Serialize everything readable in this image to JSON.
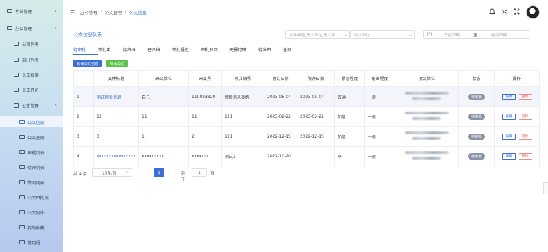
{
  "sidebar": {
    "items": [
      {
        "label": "考试管理",
        "icon": "folder-icon",
        "arrow": "∨"
      },
      {
        "label": "办公管理",
        "icon": "folder-icon",
        "arrow": "∧"
      },
      {
        "label": "公司列表",
        "icon": "folder-icon"
      },
      {
        "label": "部门列表",
        "icon": "folder-icon"
      },
      {
        "label": "员工档案",
        "icon": "folder-icon"
      },
      {
        "label": "员工评价",
        "icon": "folder-icon"
      },
      {
        "label": "公文管理",
        "icon": "folder-icon",
        "arrow": "∧"
      },
      {
        "label": "公文信息",
        "icon": "folder-icon"
      },
      {
        "label": "公文查阅",
        "icon": "folder-icon"
      },
      {
        "label": "审批列表",
        "icon": "folder-icon"
      },
      {
        "label": "待办列表",
        "icon": "folder-icon"
      },
      {
        "label": "传阅列表",
        "icon": "folder-icon"
      },
      {
        "label": "公文审批流",
        "icon": "folder-icon"
      },
      {
        "label": "公文附件",
        "icon": "folder-icon"
      },
      {
        "label": "我的收藏",
        "icon": "folder-icon"
      },
      {
        "label": "常用语",
        "icon": "folder-icon"
      }
    ]
  },
  "header": {
    "menu_icon": "☰",
    "breadcrumb": [
      "办公管理",
      "公文管理",
      "公文信息"
    ],
    "sep": "/",
    "icons": [
      "bell-icon",
      "tools-icon",
      "fullscreen-icon"
    ]
  },
  "main": {
    "title": "公文信息列表",
    "search": {
      "keyword_placeholder": "文件标题/来文单位/来文号",
      "unit_placeholder": "收文单位",
      "search_icon": "⌕",
      "date_start_placeholder": "开始日期",
      "date_to": "至",
      "date_end_placeholder": "结束日期"
    },
    "tabs": [
      "待审批",
      "审批中",
      "待归档",
      "已归档",
      "审批通过",
      "审批驳回",
      "无需过审",
      "待发布",
      "全部"
    ],
    "buttons": {
      "add": "新增公文信息",
      "export": "导出公文"
    },
    "table": {
      "columns": [
        "",
        "文件标题",
        "来文单位",
        "来文号",
        "收文编号",
        "收文日期",
        "限办日期",
        "紧急程度",
        "秘密程度",
        "收文单位",
        "状态",
        "操作"
      ],
      "rows": [
        {
          "idx": "1",
          "title": "测试模板消息",
          "from": "自己",
          "doc_no": "110023320",
          "recv_no": "模板消息提醒",
          "recv_date": "2023-05-04",
          "limit_date": "2023-05-04",
          "urgency": "普通",
          "secret": "一般",
          "status": "待审批",
          "edit": "编辑",
          "delete": "删除"
        },
        {
          "idx": "2",
          "title": "11",
          "from": "11",
          "doc_no": "11",
          "recv_no": "111",
          "recv_date": "2023-02-22",
          "limit_date": "2023-02-22",
          "urgency": "加急",
          "secret": "一般",
          "status": "待审批",
          "edit": "编辑",
          "delete": "删除"
        },
        {
          "idx": "3",
          "title": "3",
          "from": "1",
          "doc_no": "2",
          "recv_no": "111",
          "recv_date": "2022-12-15",
          "limit_date": "2022-12-15",
          "urgency": "加急",
          "secret": "一般",
          "status": "待审批",
          "edit": "编辑",
          "delete": "删除"
        },
        {
          "idx": "4",
          "title": "xxxxxxxxxxxxxxxx",
          "from": "xxxxxxxxx",
          "doc_no": "xxxxxxx",
          "recv_no": "测试1",
          "recv_date": "2022-10-20",
          "limit_date": "",
          "urgency": "平",
          "secret": "一般",
          "status": "待审批",
          "edit": "编辑",
          "delete": "删除"
        }
      ]
    },
    "pagination": {
      "total": "共 4 条",
      "page_size": "10条/页",
      "prev": "‹",
      "current": "1",
      "next": "›",
      "goto": "前往",
      "goto_value": "1",
      "page_unit": "页"
    }
  }
}
